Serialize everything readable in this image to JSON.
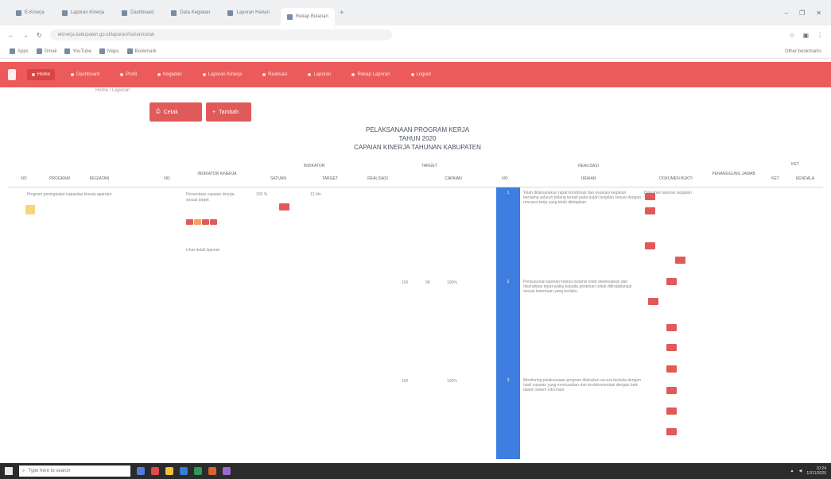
{
  "browser": {
    "tabs": [
      {
        "label": "E-Kinerja"
      },
      {
        "label": "Laporan Kinerja"
      },
      {
        "label": "Dashboard"
      },
      {
        "label": "Data Kegiatan"
      },
      {
        "label": "Laporan Harian"
      },
      {
        "label": "Rekap Bulanan",
        "active": true
      }
    ],
    "new_tab": "+",
    "window_controls": [
      "–",
      "❐",
      "✕"
    ],
    "url": "ekinerja.kabupaten.go.id/laporan/harian/cetak",
    "bookmarks": [
      "Apps",
      "Gmail",
      "YouTube",
      "Maps",
      "Bookmark"
    ],
    "bookmarks_right": "Other bookmarks"
  },
  "navbar": {
    "items": [
      {
        "label": "Home",
        "active": true
      },
      {
        "label": "Dashboard"
      },
      {
        "label": "Profil"
      },
      {
        "label": "Kegiatan"
      },
      {
        "label": "Laporan Kinerja"
      },
      {
        "label": "Realisasi"
      },
      {
        "label": "Laporan"
      },
      {
        "label": "Rekap Laporan"
      },
      {
        "label": "Logout"
      }
    ]
  },
  "breadcrumb": "Home / Laporan",
  "actions": {
    "print_label": "Cetak",
    "add_label": "Tambah"
  },
  "report": {
    "line1": "PELAKSANAAN PROGRAM KERJA",
    "line2": "TAHUN 2020",
    "line3": "CAPAIAN KINERJA TAHUNAN KABUPATEN"
  },
  "table": {
    "headers": [
      "NO",
      "PROGRAM",
      "KEGIATAN",
      "NO",
      "INDIKATOR KINERJA",
      "SATUAN",
      "TARGET",
      "REALISASI",
      "CAPAIAN",
      "NO",
      "URAIAN",
      "DOKUMEN BUKTI",
      "PENANGGUNG JAWAB",
      "KET",
      "KENDALA"
    ],
    "group_headers": [
      "INDIKATOR",
      "TARGET",
      "REALISASI",
      "KET"
    ],
    "row_program": "Program peningkatan kapasitas kinerja aparatur",
    "row_indicator": "Persentase capaian kinerja sesuai target",
    "row_target_a": "100 %",
    "row_target_b": "12 bln",
    "numbers": [
      "1",
      "2",
      "3"
    ],
    "values": [
      "100",
      "98",
      "100"
    ],
    "percent": [
      "100%",
      "98%",
      "100%"
    ],
    "desc_1": "Telah dilaksanakan rapat koordinasi dan evaluasi kegiatan bersama seluruh bidang terkait pada bulan berjalan sesuai dengan rencana kerja yang telah ditetapkan.",
    "desc_2": "Penyusunan laporan kinerja instansi telah diselesaikan dan diserahkan tepat waktu kepada pimpinan untuk ditindaklanjuti sesuai ketentuan yang berlaku.",
    "desc_3": "Monitoring pelaksanaan program dilakukan secara berkala dengan hasil capaian yang memuaskan dan terdokumentasi dengan baik dalam sistem informasi.",
    "proof": "Dokumen laporan kegiatan",
    "footer_link": "Lihat detail laporan"
  },
  "taskbar": {
    "search_placeholder": "Type here to search",
    "clock": "10:24",
    "date": "12/11/2020"
  },
  "colors": {
    "navbar": "#ec5b5b",
    "accent_blue": "#3d7ee0",
    "button_red": "#e05a5a"
  }
}
